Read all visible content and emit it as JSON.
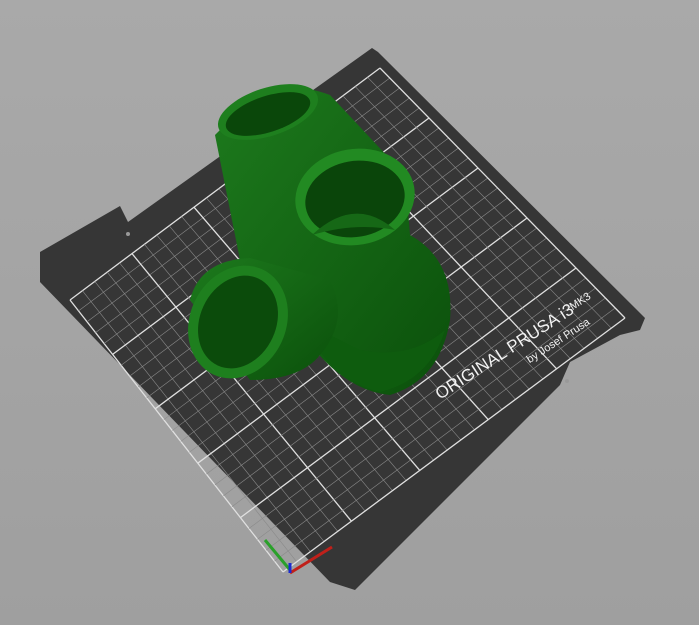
{
  "bed": {
    "brand_label": "ORIGINAL PRUSA i3",
    "model_label": "MK3",
    "author_label": "by Josef Prusa",
    "grid_divisions": 25,
    "colors": {
      "background": "#a6a6a6",
      "bed": "#3a3a3a",
      "grid": "#cfcfcf",
      "model": "#0f6a0f"
    }
  },
  "axes": {
    "x_color": "#c0201a",
    "y_color": "#2aa02a",
    "z_color": "#1a2ad0"
  }
}
